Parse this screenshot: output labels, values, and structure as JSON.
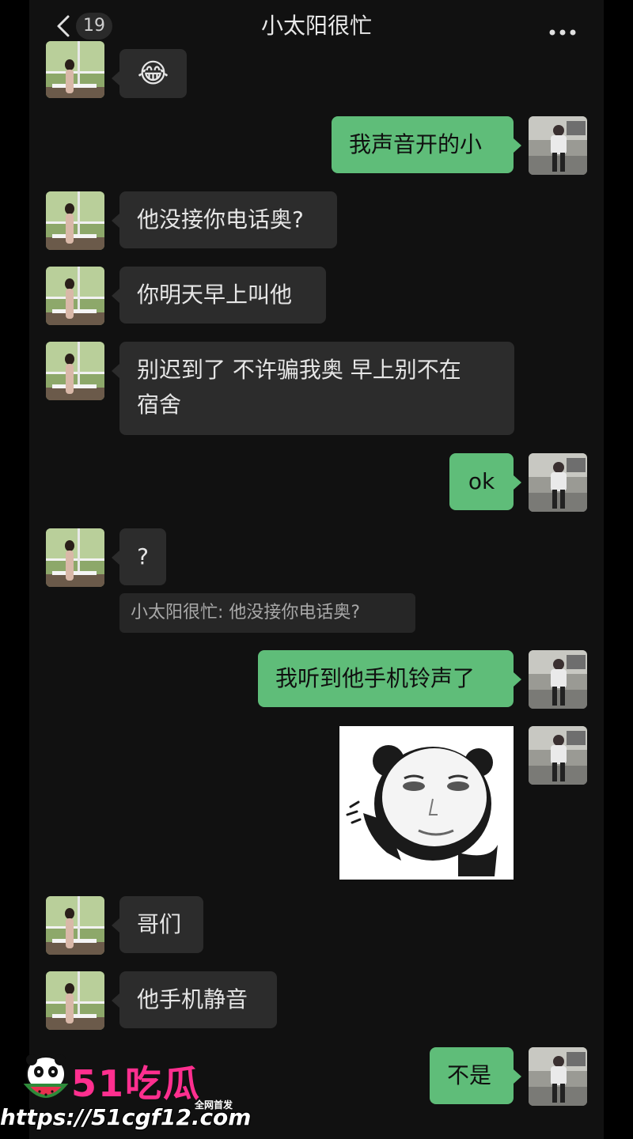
{
  "header": {
    "back_icon": "chevron-left-icon",
    "unread_count": "19",
    "title": "小太阳很忙",
    "more_icon": "more-dots-icon"
  },
  "messages": [
    {
      "side": "in",
      "type": "emoji",
      "text": "😂"
    },
    {
      "side": "out",
      "type": "text",
      "text": "我声音开的小"
    },
    {
      "side": "in",
      "type": "text",
      "text": "他没接你电话奥?"
    },
    {
      "side": "in",
      "type": "text",
      "text": "你明天早上叫他"
    },
    {
      "side": "in",
      "type": "text",
      "line1": "别迟到了 不许骗我奥 早上别不在",
      "line2": "宿舍"
    },
    {
      "side": "out",
      "type": "text",
      "text": "ok"
    },
    {
      "side": "in",
      "type": "text",
      "text": "?",
      "quote": "小太阳很忙: 他没接你电话奥?"
    },
    {
      "side": "out",
      "type": "text",
      "text": "我听到他手机铃声了"
    },
    {
      "side": "out",
      "type": "sticker",
      "sticker": "panda-meme"
    },
    {
      "side": "in",
      "type": "text",
      "text": "哥们"
    },
    {
      "side": "in",
      "type": "text",
      "text": "他手机静音"
    },
    {
      "side": "out",
      "type": "text",
      "text": "不是"
    }
  ],
  "watermark": {
    "brand": "51吃瓜",
    "tag": "全网首发",
    "url": "https://51cgf12.com"
  }
}
